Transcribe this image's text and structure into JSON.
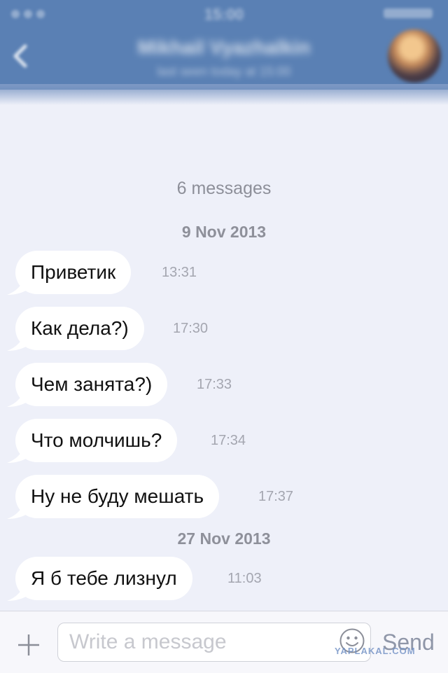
{
  "header": {
    "status_time": "15:00",
    "contact_name": "Mikhail Vyazhalkin",
    "contact_status": "last seen today at 15:00"
  },
  "conversation": {
    "count_label": "6 messages",
    "groups": [
      {
        "date": "9 Nov 2013",
        "messages": [
          {
            "text": "Приветик",
            "time": "13:31"
          },
          {
            "text": "Как дела?)",
            "time": "17:30"
          },
          {
            "text": "Чем занята?)",
            "time": "17:33"
          },
          {
            "text": "Что молчишь?",
            "time": "17:34"
          },
          {
            "text": "Ну не буду мешать",
            "time": "17:37"
          }
        ]
      },
      {
        "date": "27 Nov 2013",
        "messages": [
          {
            "text": "Я б тебе лизнул",
            "time": "11:03"
          }
        ]
      }
    ]
  },
  "input": {
    "placeholder": "Write a message",
    "send_label": "Send"
  },
  "watermark": "YAPLAKAL.COM",
  "colors": {
    "header": "#5a80b4",
    "background": "#eef0f9",
    "bubble": "#ffffff",
    "meta_text": "#8e909a"
  }
}
